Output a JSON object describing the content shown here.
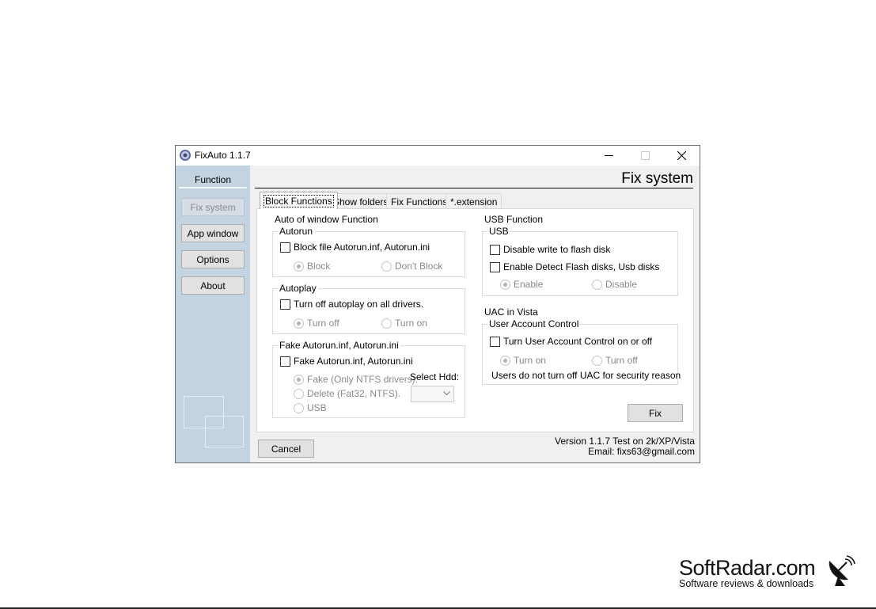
{
  "window": {
    "title": "FixAuto 1.1.7"
  },
  "sidebar": {
    "header": "Function",
    "buttons": {
      "fix_system": "Fix system",
      "app_window": "App window",
      "options": "Options",
      "about": "About"
    }
  },
  "main": {
    "page_title": "Fix system",
    "tabs": [
      "Block Functions",
      "Show folders",
      "Fix Functions",
      "*.extension"
    ],
    "left": {
      "section_title": "Auto of window Function",
      "autorun": {
        "legend": "Autorun",
        "checkbox": "Block file Autorun.inf, Autorun.ini",
        "radio_block": "Block",
        "radio_dont_block": "Don't Block"
      },
      "autoplay": {
        "legend": "Autoplay",
        "checkbox": "Turn off autoplay on all drivers.",
        "radio_off": "Turn off",
        "radio_on": "Turn on"
      },
      "fake": {
        "legend": "Fake Autorun.inf, Autorun.ini",
        "checkbox": "Fake Autorun.inf, Autorun.ini",
        "radio_fake": "Fake (Only NTFS drivers).",
        "radio_delete": "Delete (Fat32, NTFS).",
        "radio_usb": "USB",
        "select_label": "Select Hdd:",
        "select_value": ""
      }
    },
    "right": {
      "section_title": "USB Function",
      "usb": {
        "legend": "USB",
        "checkbox_write": "Disable write to flash disk",
        "checkbox_detect": "Enable Detect Flash disks, Usb disks",
        "radio_enable": "Enable",
        "radio_disable": "Disable"
      },
      "uac_title": "UAC in Vista",
      "uac": {
        "legend": "User Account Control",
        "checkbox": "Turn User Account Control on or off",
        "radio_on": "Turn on",
        "radio_off": "Turn off",
        "note": "Users do not turn off UAC for security reason"
      },
      "fix_button": "Fix"
    },
    "cancel_button": "Cancel",
    "version_line1": "Version 1.1.7 Test on 2k/XP/Vista",
    "version_line2": "Email: fixs63@gmail.com"
  },
  "watermark": {
    "name": "SoftRadar.com",
    "tagline": "Software reviews & downloads"
  }
}
